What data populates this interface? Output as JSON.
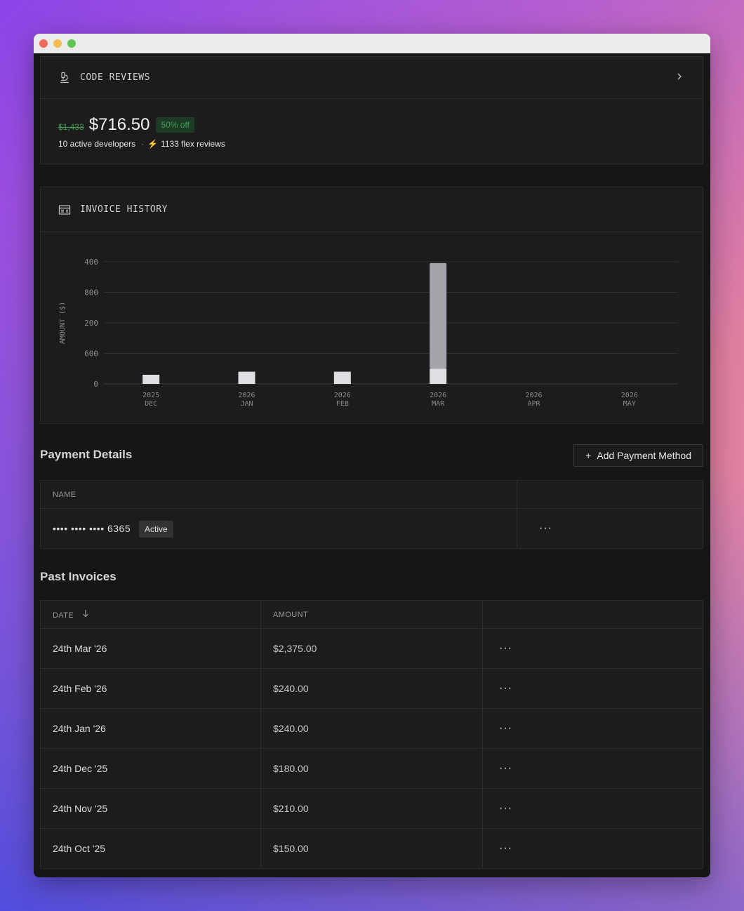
{
  "code_reviews": {
    "title": "CODE REVIEWS",
    "icon": "microscope-icon",
    "old_price": "$1,433",
    "price": "$716.50",
    "discount": "50% off",
    "developers": "10 active developers",
    "separator": "·",
    "flex_reviews": "1133 flex reviews"
  },
  "invoice_history": {
    "title": "INVOICE HISTORY",
    "icon": "receipt-icon"
  },
  "chart_data": {
    "type": "bar",
    "ylabel": "AMOUNT ($)",
    "yticks": [
      "400",
      "800",
      "200",
      "600",
      "0"
    ],
    "categories": [
      {
        "year": "2025",
        "month": "DEC"
      },
      {
        "year": "2026",
        "month": "JAN"
      },
      {
        "year": "2026",
        "month": "FEB"
      },
      {
        "year": "2026",
        "month": "MAR"
      },
      {
        "year": "2026",
        "month": "APR"
      },
      {
        "year": "2026",
        "month": "MAY"
      }
    ],
    "values": [
      180,
      240,
      240,
      2375,
      0,
      0
    ],
    "ylim": [
      0,
      2400
    ],
    "stacked_light_portion": [
      180,
      240,
      240,
      300,
      0,
      0
    ],
    "grid": true
  },
  "payment_details": {
    "title": "Payment Details",
    "add_button": "Add Payment Method",
    "column_name": "NAME",
    "card_masked": "•••• •••• •••• 6365",
    "status": "Active",
    "more": "···"
  },
  "past_invoices": {
    "title": "Past Invoices",
    "col_date": "DATE",
    "col_amount": "AMOUNT",
    "rows": [
      {
        "date": "24th Mar '26",
        "amount": "$2,375.00",
        "more": "···"
      },
      {
        "date": "24th Feb '26",
        "amount": "$240.00",
        "more": "···"
      },
      {
        "date": "24th Jan '26",
        "amount": "$240.00",
        "more": "···"
      },
      {
        "date": "24th Dec '25",
        "amount": "$180.00",
        "more": "···"
      },
      {
        "date": "24th Nov '25",
        "amount": "$210.00",
        "more": "···"
      },
      {
        "date": "24th Oct '25",
        "amount": "$150.00",
        "more": "···"
      }
    ]
  }
}
